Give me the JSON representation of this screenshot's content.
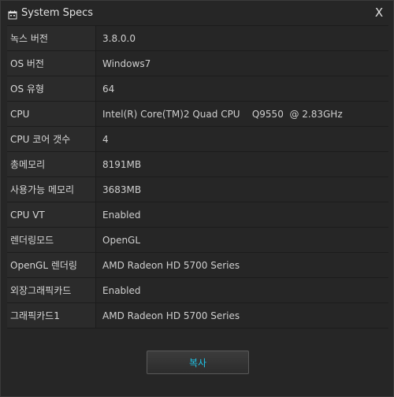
{
  "window": {
    "title": "System Specs",
    "close_glyph": "X"
  },
  "specs": [
    {
      "key": "녹스 버전",
      "value": "3.8.0.0"
    },
    {
      "key": "OS 버전",
      "value": "Windows7"
    },
    {
      "key": "OS 유형",
      "value": "64"
    },
    {
      "key": "CPU",
      "value": "Intel(R) Core(TM)2 Quad CPU    Q9550  @ 2.83GHz"
    },
    {
      "key": "CPU 코어 갯수",
      "value": "4"
    },
    {
      "key": "총메모리",
      "value": "8191MB"
    },
    {
      "key": "사용가능 메모리",
      "value": "3683MB"
    },
    {
      "key": "CPU VT",
      "value": "Enabled"
    },
    {
      "key": "렌더링모드",
      "value": "OpenGL"
    },
    {
      "key": "OpenGL 렌더링",
      "value": "AMD Radeon HD 5700 Series"
    },
    {
      "key": "외장그래픽카드",
      "value": "Enabled"
    },
    {
      "key": "그래픽카드1",
      "value": "AMD Radeon HD 5700 Series"
    }
  ],
  "copy_button": {
    "label": "복사"
  },
  "colors": {
    "accent": "#1fc4e8",
    "background": "#262626",
    "key_cell": "#2b2b2b"
  },
  "icons": {
    "title": "calendar-icon",
    "close": "close-icon"
  }
}
